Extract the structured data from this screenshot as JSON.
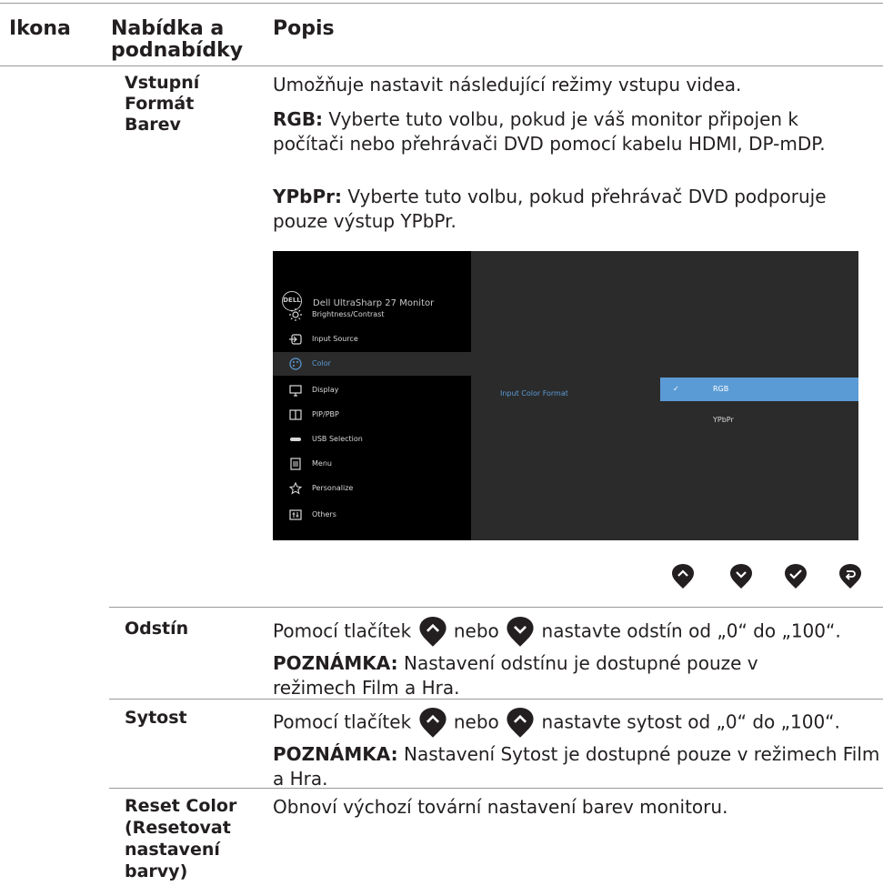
{
  "table": {
    "headers": {
      "icon": "Ikona",
      "menu": "Nabídka a\npodnabídky",
      "desc": "Popis"
    }
  },
  "rows": {
    "input_color": {
      "name": "Vstupní\nFormát\nBarev",
      "intro": "Umožňuje nastavit následující režimy vstupu videa.",
      "rgb_label": "RGB:",
      "rgb_text": " Vyberte tuto volbu, pokud je váš monitor připojen k počítači nebo přehrávači DVD pomocí kabelu HDMI, DP-mDP.",
      "ypbpr_label": "YPbPr:",
      "ypbpr_text": " Vyberte tuto volbu, pokud přehrávač DVD podporuje pouze výstup YPbPr."
    },
    "hue": {
      "name": "Odstín",
      "text_a": "Pomocí tlačítek",
      "text_b": "nebo",
      "text_c": "nastavte odstín od „0“ do „100“.",
      "note_label": "POZNÁMKA:",
      "note_text": " Nastavení odstínu je dostupné pouze v režimech Film a Hra."
    },
    "saturation": {
      "name": "Sytost",
      "text_a": "Pomocí tlačítek",
      "text_b": "nebo",
      "text_c": "nastavte sytost od „0“ do „100“.",
      "note_label": "POZNÁMKA:",
      "note_text": " Nastavení Sytost je dostupné pouze v režimech Film a Hra."
    },
    "reset": {
      "name": "Reset Color\n(Resetovat\nnastavení\nbarvy)",
      "text": "Obnoví výchozí tovární nastavení barev monitoru."
    }
  },
  "osd": {
    "logo": "DELL",
    "title": "Dell UltraSharp 27 Monitor",
    "menu": [
      {
        "label": "Brightness/Contrast",
        "icon": "sun-icon"
      },
      {
        "label": "Input Source",
        "icon": "input-icon"
      },
      {
        "label": "Color",
        "icon": "palette-icon"
      },
      {
        "label": "Display",
        "icon": "monitor-icon"
      },
      {
        "label": "PIP/PBP",
        "icon": "pip-icon"
      },
      {
        "label": "USB Selection",
        "icon": "usb-icon"
      },
      {
        "label": "Menu",
        "icon": "menu-icon"
      },
      {
        "label": "Personalize",
        "icon": "star-icon"
      },
      {
        "label": "Others",
        "icon": "others-icon"
      }
    ],
    "active_item": "Color",
    "field_label": "Input Color Format",
    "options": [
      "RGB",
      "YPbPr"
    ],
    "selected_option": "RGB",
    "colors": {
      "accent": "#5b9bd5",
      "panel": "#2b2b2b",
      "sidebar": "#000000"
    }
  },
  "buttons": [
    "up-button",
    "down-button",
    "ok-button",
    "back-button"
  ]
}
